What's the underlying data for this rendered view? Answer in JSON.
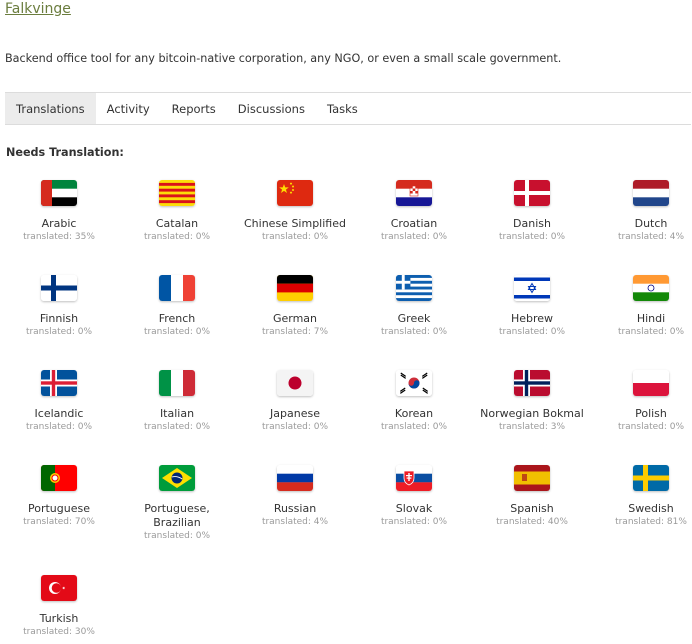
{
  "project": {
    "title": "Falkvinge",
    "description": "Backend office tool for any bitcoin-native corporation, any NGO, or even a small scale government."
  },
  "tabs": [
    {
      "label": "Translations",
      "active": true
    },
    {
      "label": "Activity"
    },
    {
      "label": "Reports"
    },
    {
      "label": "Discussions"
    },
    {
      "label": "Tasks"
    }
  ],
  "section_title": "Needs Translation:",
  "languages": [
    {
      "name": "Arabic",
      "progress": "translated: 35%",
      "flag_icon": "arabic-flag-icon"
    },
    {
      "name": "Catalan",
      "progress": "translated: 0%",
      "flag_icon": "catalan-flag-icon"
    },
    {
      "name": "Chinese Simplified",
      "progress": "translated: 0%",
      "flag_icon": "china-flag-icon"
    },
    {
      "name": "Croatian",
      "progress": "translated: 0%",
      "flag_icon": "croatia-flag-icon"
    },
    {
      "name": "Danish",
      "progress": "translated: 0%",
      "flag_icon": "denmark-flag-icon"
    },
    {
      "name": "Dutch",
      "progress": "translated: 4%",
      "flag_icon": "netherlands-flag-icon"
    },
    {
      "name": "Finnish",
      "progress": "translated: 0%",
      "flag_icon": "finland-flag-icon"
    },
    {
      "name": "French",
      "progress": "translated: 0%",
      "flag_icon": "france-flag-icon"
    },
    {
      "name": "German",
      "progress": "translated: 7%",
      "flag_icon": "germany-flag-icon"
    },
    {
      "name": "Greek",
      "progress": "translated: 0%",
      "flag_icon": "greece-flag-icon"
    },
    {
      "name": "Hebrew",
      "progress": "translated: 0%",
      "flag_icon": "israel-flag-icon"
    },
    {
      "name": "Hindi",
      "progress": "translated: 0%",
      "flag_icon": "india-flag-icon"
    },
    {
      "name": "Icelandic",
      "progress": "translated: 0%",
      "flag_icon": "iceland-flag-icon"
    },
    {
      "name": "Italian",
      "progress": "translated: 0%",
      "flag_icon": "italy-flag-icon"
    },
    {
      "name": "Japanese",
      "progress": "translated: 0%",
      "flag_icon": "japan-flag-icon"
    },
    {
      "name": "Korean",
      "progress": "translated: 0%",
      "flag_icon": "korea-flag-icon"
    },
    {
      "name": "Norwegian Bokmal",
      "progress": "translated: 3%",
      "flag_icon": "norway-flag-icon"
    },
    {
      "name": "Polish",
      "progress": "translated: 0%",
      "flag_icon": "poland-flag-icon"
    },
    {
      "name": "Portuguese",
      "progress": "translated: 70%",
      "flag_icon": "portugal-flag-icon"
    },
    {
      "name": "Portuguese, Brazilian",
      "progress": "translated: 0%",
      "flag_icon": "brazil-flag-icon"
    },
    {
      "name": "Russian",
      "progress": "translated: 4%",
      "flag_icon": "russia-flag-icon"
    },
    {
      "name": "Slovak",
      "progress": "translated: 0%",
      "flag_icon": "slovakia-flag-icon"
    },
    {
      "name": "Spanish",
      "progress": "translated: 40%",
      "flag_icon": "spain-flag-icon"
    },
    {
      "name": "Swedish",
      "progress": "translated: 81%",
      "flag_icon": "sweden-flag-icon"
    },
    {
      "name": "Turkish",
      "progress": "translated: 30%",
      "flag_icon": "turkey-flag-icon"
    }
  ],
  "colors": {
    "link": "#6b7d3e",
    "active_tab_bg": "#ececec",
    "muted_text": "#9a9a9a"
  }
}
